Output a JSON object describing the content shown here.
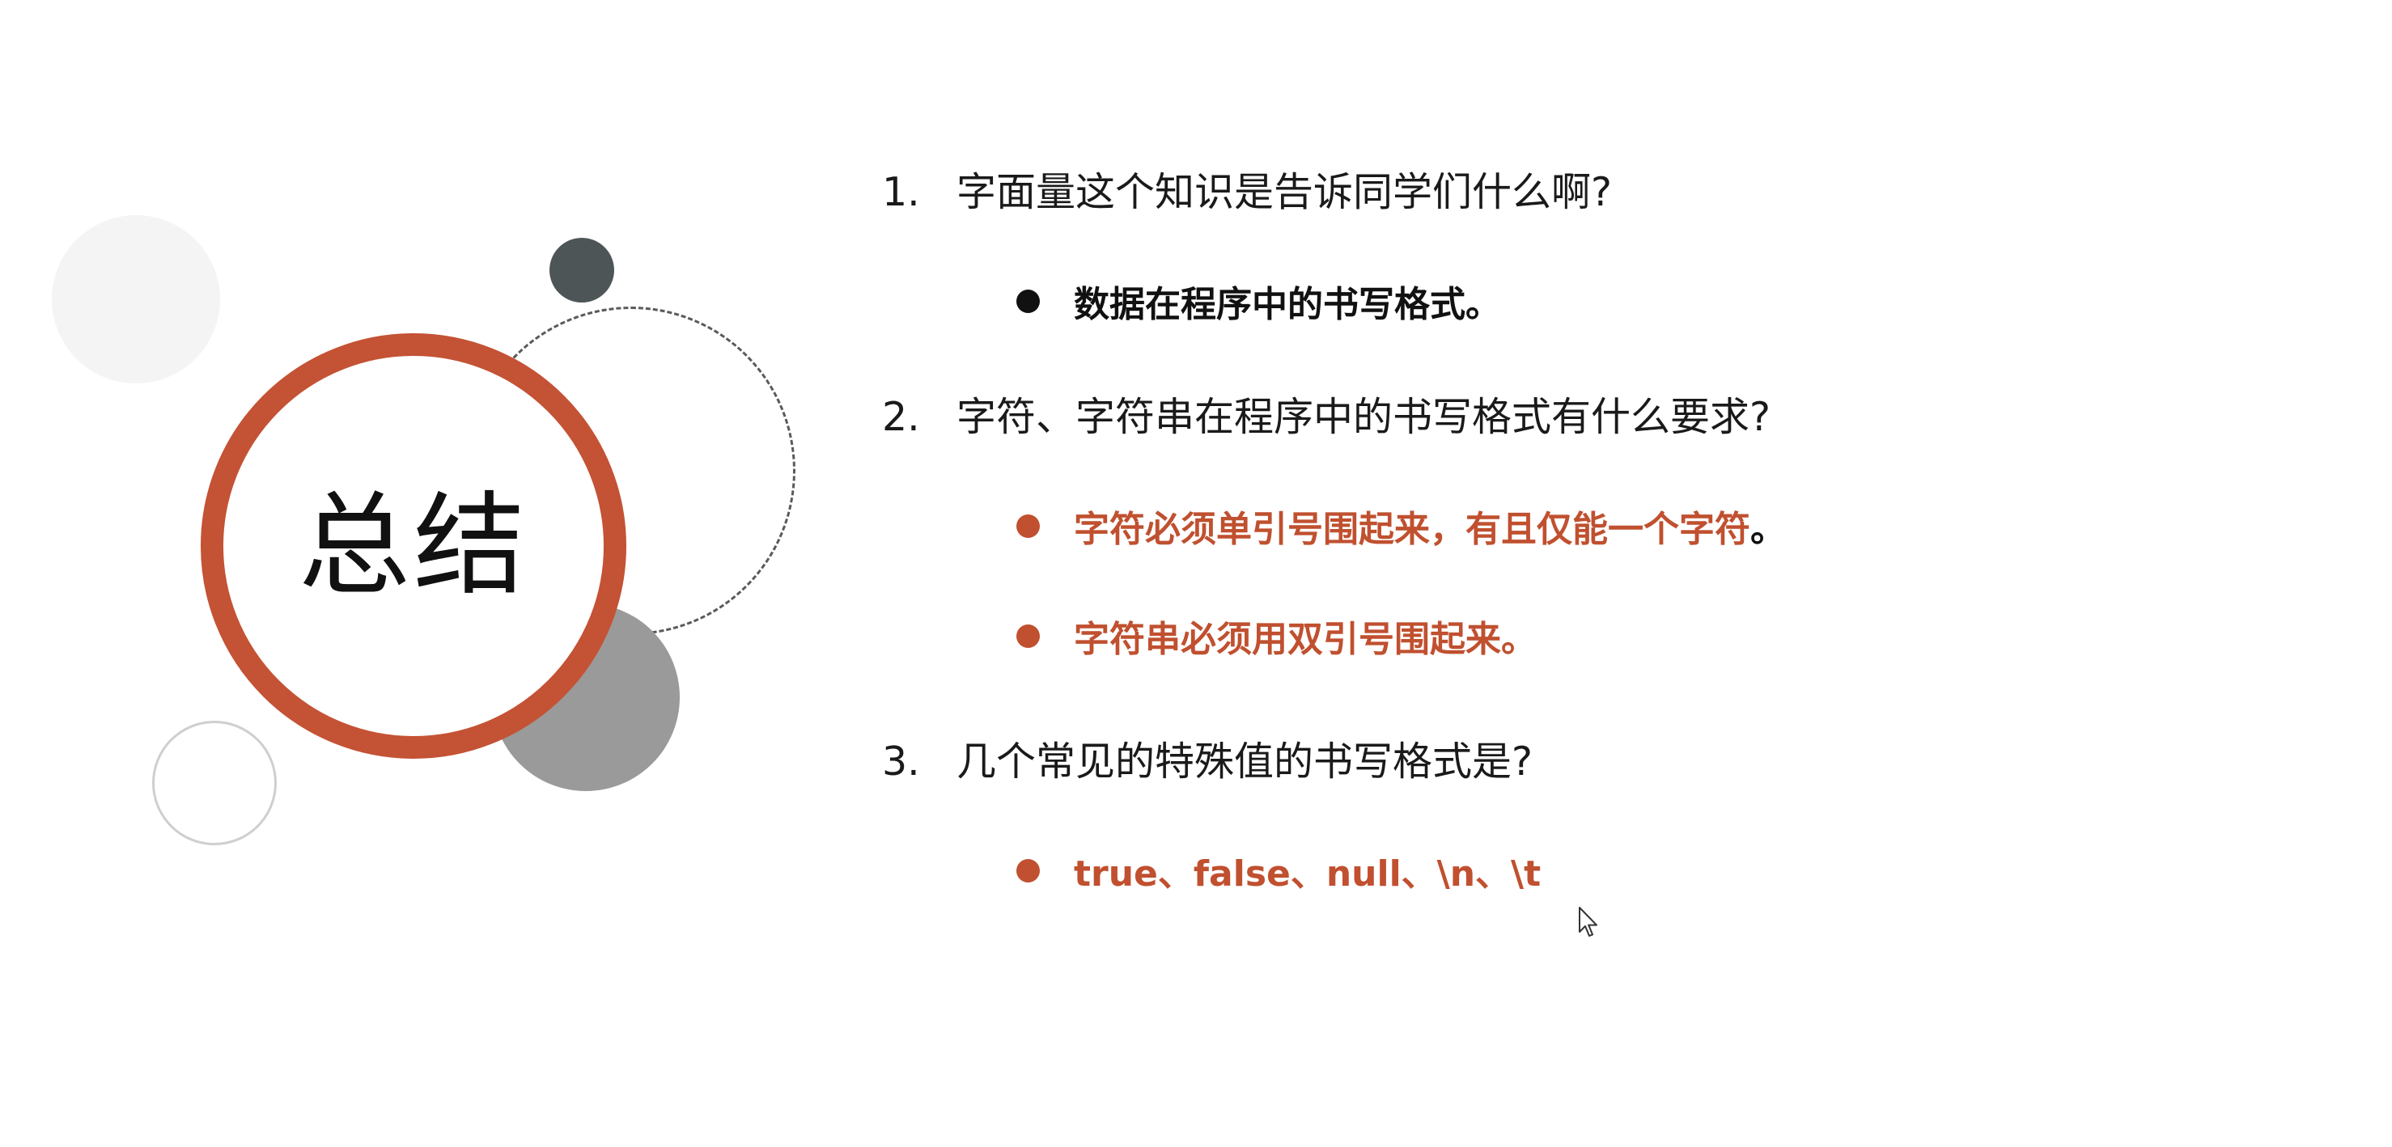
{
  "slide": {
    "title": "总结",
    "colors": {
      "accent": "#c45234",
      "answer_red": "#c0502f",
      "text": "#1a1a1a",
      "dark_circle": "#4e5557",
      "gray_circle": "#9a9a9a"
    },
    "questions": [
      {
        "number": "1.",
        "text": "字面量这个知识是告诉同学们什么啊?",
        "answers": [
          {
            "text": "数据在程序中的书写格式。",
            "tail": ""
          }
        ]
      },
      {
        "number": "2.",
        "text": "字符、字符串在程序中的书写格式有什么要求?",
        "answers": [
          {
            "text": "字符必须单引号围起来，有且仅能一个字符",
            "tail": "。"
          },
          {
            "text": "字符串必须用双引号围起来。",
            "tail": ""
          }
        ]
      },
      {
        "number": "3.",
        "text": "几个常见的特殊值的书写格式是?",
        "answers": [
          {
            "text": "true、false、null、\\n、\\t",
            "tail": ""
          }
        ]
      }
    ]
  }
}
